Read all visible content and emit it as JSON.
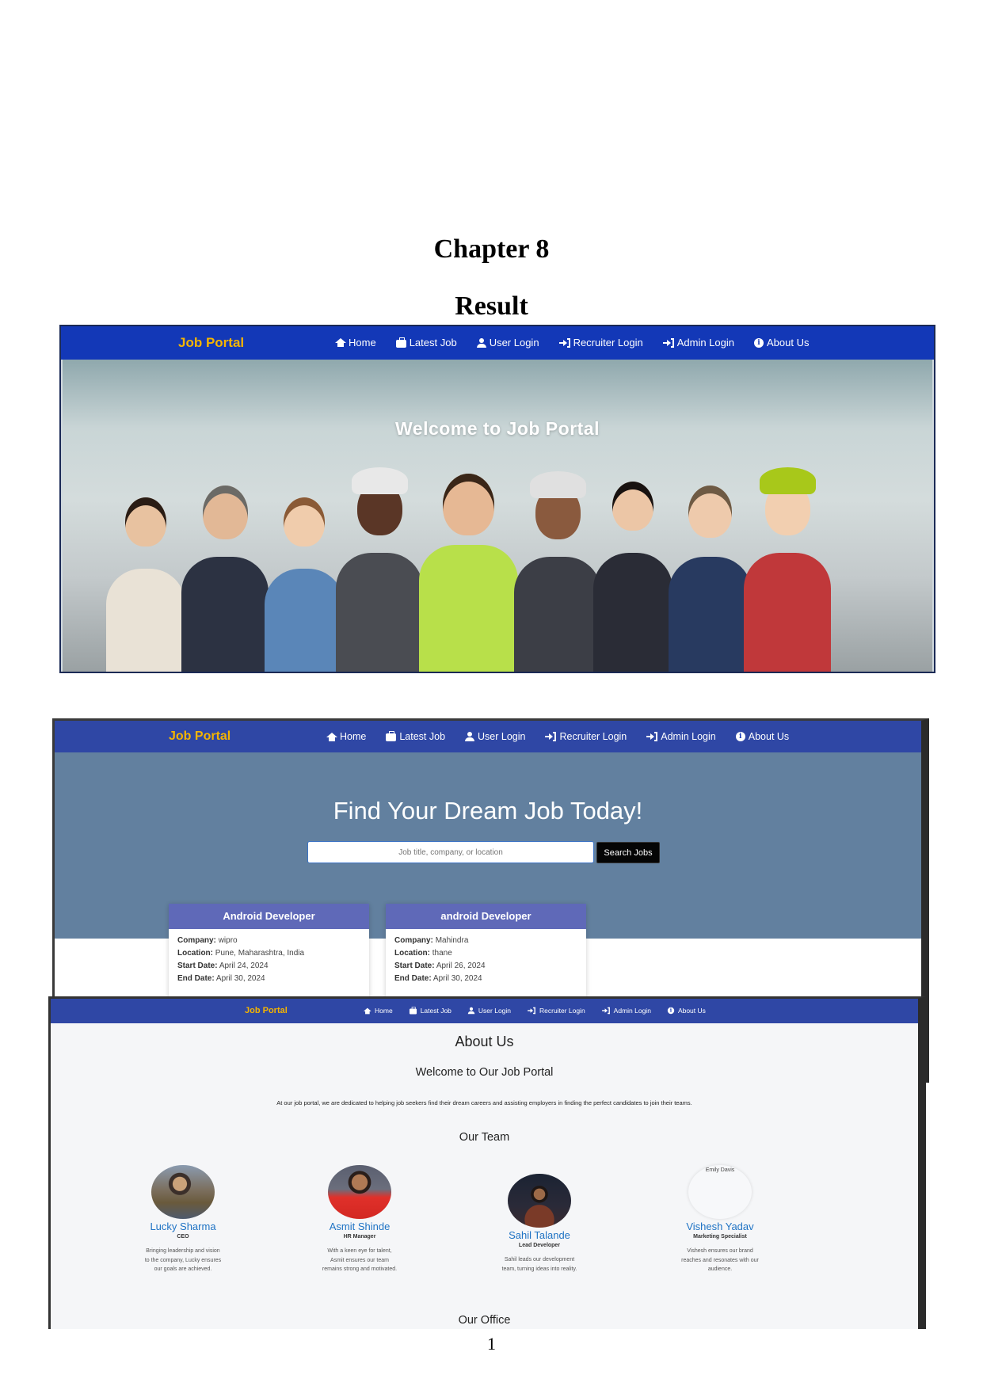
{
  "document": {
    "chapter": "Chapter 8",
    "section": "Result",
    "page_number": "1"
  },
  "nav": {
    "brand": "Job Portal",
    "items": [
      {
        "label": "Home",
        "icon": "home-icon"
      },
      {
        "label": "Latest Job",
        "icon": "briefcase-icon"
      },
      {
        "label": "User Login",
        "icon": "user-icon"
      },
      {
        "label": "Recruiter Login",
        "icon": "sign-in-icon"
      },
      {
        "label": "Admin Login",
        "icon": "sign-in-icon"
      },
      {
        "label": "About Us",
        "icon": "info-icon"
      }
    ]
  },
  "colors": {
    "navbar_primary": "#1338b7",
    "navbar_secondary": "#2f47a5",
    "brand_text": "#f4b400",
    "search_hero_bg": "#62809f",
    "card_header": "#5f69b8",
    "team_name": "#1f73c4"
  },
  "home": {
    "hero_title": "Welcome to Job Portal"
  },
  "jobs_page": {
    "title": "Find Your Dream Job Today!",
    "search_placeholder": "Job title, company, or location",
    "search_button": "Search Jobs",
    "jobs": [
      {
        "title": "Android Developer",
        "company_label": "Company:",
        "company": "wipro",
        "location_label": "Location:",
        "location": "Pune, Maharashtra, India",
        "start_label": "Start Date:",
        "start": "April 24, 2024",
        "end_label": "End Date:",
        "end": "April 30, 2024"
      },
      {
        "title": "android Developer",
        "company_label": "Company:",
        "company": "Mahindra",
        "location_label": "Location:",
        "location": "thane",
        "start_label": "Start Date:",
        "start": "April 26, 2024",
        "end_label": "End Date:",
        "end": "April 30, 2024"
      }
    ]
  },
  "about_page": {
    "title": "About Us",
    "welcome": "Welcome to Our Job Portal",
    "intro": "At our job portal, we are dedicated to helping job seekers find their dream careers and assisting employers in finding the perfect candidates to join their teams.",
    "team_title": "Our Team",
    "team": [
      {
        "name": "Lucky Sharma",
        "role": "CEO",
        "bio": "Bringing leadership and vision to the company, Lucky ensures our goals are achieved."
      },
      {
        "name": "Asmit Shinde",
        "role": "HR Manager",
        "bio": "With a keen eye for talent, Asmit ensures our team remains strong and motivated."
      },
      {
        "name": "Sahil Talande",
        "role": "Lead Developer",
        "bio": "Sahil leads our development team, turning ideas into reality."
      },
      {
        "name": "Vishesh Yadav",
        "role": "Marketing Specialist",
        "bio": "Vishesh ensures our brand reaches and resonates with our audience.",
        "image_alt": "Emily Davis"
      }
    ],
    "office_title": "Our Office"
  }
}
